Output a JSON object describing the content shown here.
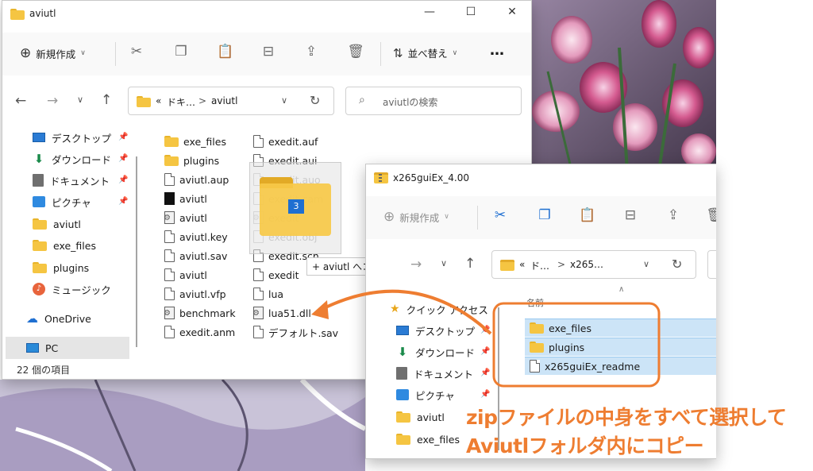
{
  "back_window": {
    "title": "aviutl",
    "toolbar": {
      "new_label": "新規作成",
      "sort_label": "並べ替え",
      "more_label": "…"
    },
    "address": {
      "prefix": "«",
      "crumb1": "ドキ…",
      "sep": ">",
      "crumb2": "aviutl"
    },
    "search_placeholder": "aviutlの検索",
    "sidebar": [
      {
        "label": "デスクトップ",
        "icon": "desktop-icon",
        "pinned": true
      },
      {
        "label": "ダウンロード",
        "icon": "download-icon",
        "pinned": true
      },
      {
        "label": "ドキュメント",
        "icon": "document-icon",
        "pinned": true
      },
      {
        "label": "ピクチャ",
        "icon": "picture-icon",
        "pinned": true
      },
      {
        "label": "aviutl",
        "icon": "folder-icon"
      },
      {
        "label": "exe_files",
        "icon": "folder-icon"
      },
      {
        "label": "plugins",
        "icon": "folder-icon"
      },
      {
        "label": "ミュージック",
        "icon": "music-icon"
      },
      {
        "label": "OneDrive",
        "icon": "cloud-icon"
      },
      {
        "label": "PC",
        "icon": "pc-icon"
      }
    ],
    "files_col1": [
      {
        "name": "exe_files",
        "icon": "folder"
      },
      {
        "name": "plugins",
        "icon": "folder"
      },
      {
        "name": "aviutl.aup",
        "icon": "doc"
      },
      {
        "name": "aviutl",
        "icon": "black"
      },
      {
        "name": "aviutl",
        "icon": "cfg"
      },
      {
        "name": "aviutl.key",
        "icon": "doc"
      },
      {
        "name": "aviutl.sav",
        "icon": "doc"
      },
      {
        "name": "aviutl",
        "icon": "doc"
      },
      {
        "name": "aviutl.vfp",
        "icon": "doc"
      },
      {
        "name": "benchmark",
        "icon": "cfg"
      },
      {
        "name": "exedit.anm",
        "icon": "doc"
      }
    ],
    "files_col2": [
      {
        "name": "exedit.auf",
        "icon": "doc"
      },
      {
        "name": "exedit.aui",
        "icon": "doc"
      },
      {
        "name": "exedit.auo",
        "icon": "doc"
      },
      {
        "name": "exedit.cam",
        "icon": "doc"
      },
      {
        "name": "exedit",
        "icon": "cfg"
      },
      {
        "name": "exedit.obj",
        "icon": "doc"
      },
      {
        "name": "exedit.scn",
        "icon": "doc"
      },
      {
        "name": "exedit",
        "icon": "doc"
      },
      {
        "name": "lua",
        "icon": "doc"
      },
      {
        "name": "lua51.dll",
        "icon": "cfg"
      },
      {
        "name": "デフォルト.sav",
        "icon": "doc"
      }
    ],
    "status": "22 個の項目"
  },
  "drag": {
    "badge": "3",
    "tooltip": "+ aviutl へコピー"
  },
  "front_window": {
    "title": "x265guiEx_4.00",
    "toolbar": {
      "new_label": "新規作成"
    },
    "address": {
      "prefix": "«",
      "crumb1": "ド…",
      "sep": ">",
      "crumb2": "x265…"
    },
    "column_header": "名前",
    "sidebar": [
      {
        "label": "クイック アクセス",
        "icon": "star-icon"
      },
      {
        "label": "デスクトップ",
        "icon": "desktop-icon",
        "pinned": true
      },
      {
        "label": "ダウンロード",
        "icon": "download-icon",
        "pinned": true
      },
      {
        "label": "ドキュメント",
        "icon": "document-icon",
        "pinned": true
      },
      {
        "label": "ピクチャ",
        "icon": "picture-icon",
        "pinned": true
      },
      {
        "label": "aviutl",
        "icon": "folder-icon"
      },
      {
        "label": "exe_files",
        "icon": "folder-icon"
      }
    ],
    "files": [
      {
        "name": "exe_files",
        "icon": "folder"
      },
      {
        "name": "plugins",
        "icon": "folder"
      },
      {
        "name": "x265guiEx_readme",
        "icon": "doc"
      }
    ]
  },
  "annotation": {
    "line1": "zipファイルの中身をすべて選択して",
    "line2": "Aviutlフォルダ内にコピー",
    "color": "#ee7d31"
  }
}
